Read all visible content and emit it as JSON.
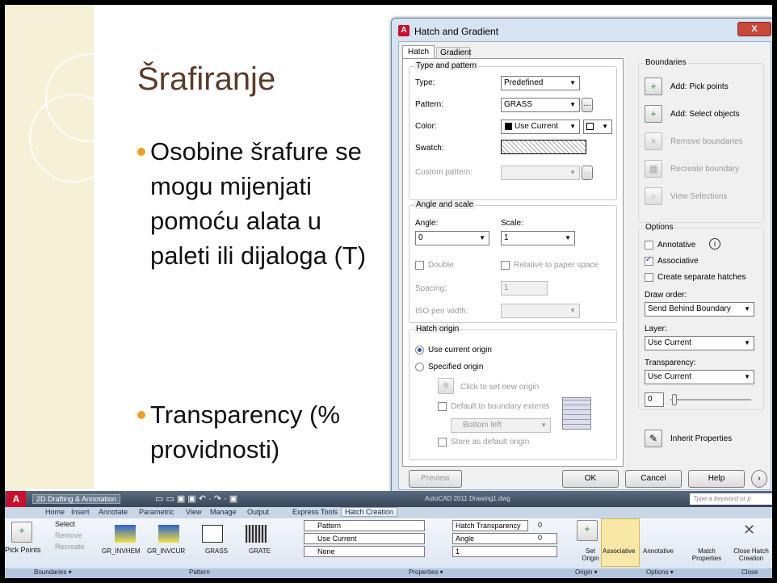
{
  "slide": {
    "title": "Šrafiranje",
    "bullets": [
      "Osobine šrafure se mogu mijenjati pomoću alata u paleti ili dijaloga (T)",
      "Transparency (% providnosti)"
    ]
  },
  "dialog": {
    "title": "Hatch and Gradient",
    "close": "X",
    "tabs": [
      "Hatch",
      "Gradient"
    ],
    "type_pattern_group": "Type and pattern",
    "type_label": "Type:",
    "type_value": "Predefined",
    "pattern_label": "Pattern:",
    "pattern_value": "GRASS",
    "color_label": "Color:",
    "color_value": "Use Current",
    "swatch_label": "Swatch:",
    "custom_pattern_label": "Custom pattern:",
    "angle_scale_group": "Angle and scale",
    "angle_label": "Angle:",
    "angle_value": "0",
    "scale_label": "Scale:",
    "scale_value": "1",
    "double_label": "Double",
    "relative_label": "Relative to paper space",
    "spacing_label": "Spacing:",
    "spacing_value": "1",
    "iso_label": "ISO pen width:",
    "hatch_origin_group": "Hatch origin",
    "use_current_origin": "Use current origin",
    "specified_origin": "Specified origin",
    "click_new_origin": "Click to set new origin",
    "default_boundary": "Default to boundary extents",
    "bottom_left": "Bottom left",
    "store_default": "Store as default origin",
    "boundaries_group": "Boundaries",
    "add_pick": "Add: Pick points",
    "add_select": "Add: Select objects",
    "remove_boundaries": "Remove boundaries",
    "recreate_boundary": "Recreate boundary",
    "view_selections": "View Selections",
    "options_group": "Options",
    "annotative": "Annotative",
    "associative": "Associative",
    "create_separate": "Create separate hatches",
    "draw_order_label": "Draw order:",
    "draw_order_value": "Send Behind Boundary",
    "layer_label": "Layer:",
    "layer_value": "Use Current",
    "transparency_label": "Transparency:",
    "transparency_value": "Use Current",
    "transparency_num": "0",
    "inherit": "Inherit Properties",
    "preview": "Preview",
    "ok": "OK",
    "cancel": "Cancel",
    "help": "Help"
  },
  "ribbon": {
    "workspace": "2D Drafting & Annotation",
    "app_title": "AutoCAD 2011   Drawing1.dwg",
    "search_placeholder": "Type a keyword or p",
    "tabs": [
      "Home",
      "Insert",
      "Annotate",
      "Parametric",
      "View",
      "Manage",
      "Output",
      "Express Tools",
      "Hatch Creation"
    ],
    "pick_points": "Pick Points",
    "select": "Select",
    "remove": "Remove",
    "recreate": "Recreate",
    "patterns": [
      "GR_INVHEM",
      "GR_INVCUR",
      "GRASS",
      "GRATE"
    ],
    "prop_pattern": "Pattern",
    "prop_color": "Use Current",
    "prop_none": "None",
    "hatch_transparency": "Hatch Transparency",
    "angle": "Angle",
    "trans_val": "0",
    "angle_val": "0",
    "scale_val": "1",
    "set_origin": "Set Origin",
    "associative": "Associative",
    "annotative": "Annotative",
    "match_properties": "Match Properties",
    "close_hatch": "Close Hatch Creation",
    "panel_labels": [
      "Boundaries ▾",
      "Pattern",
      "Properties ▾",
      "Origin ▾",
      "Options ▾",
      "Close"
    ]
  }
}
